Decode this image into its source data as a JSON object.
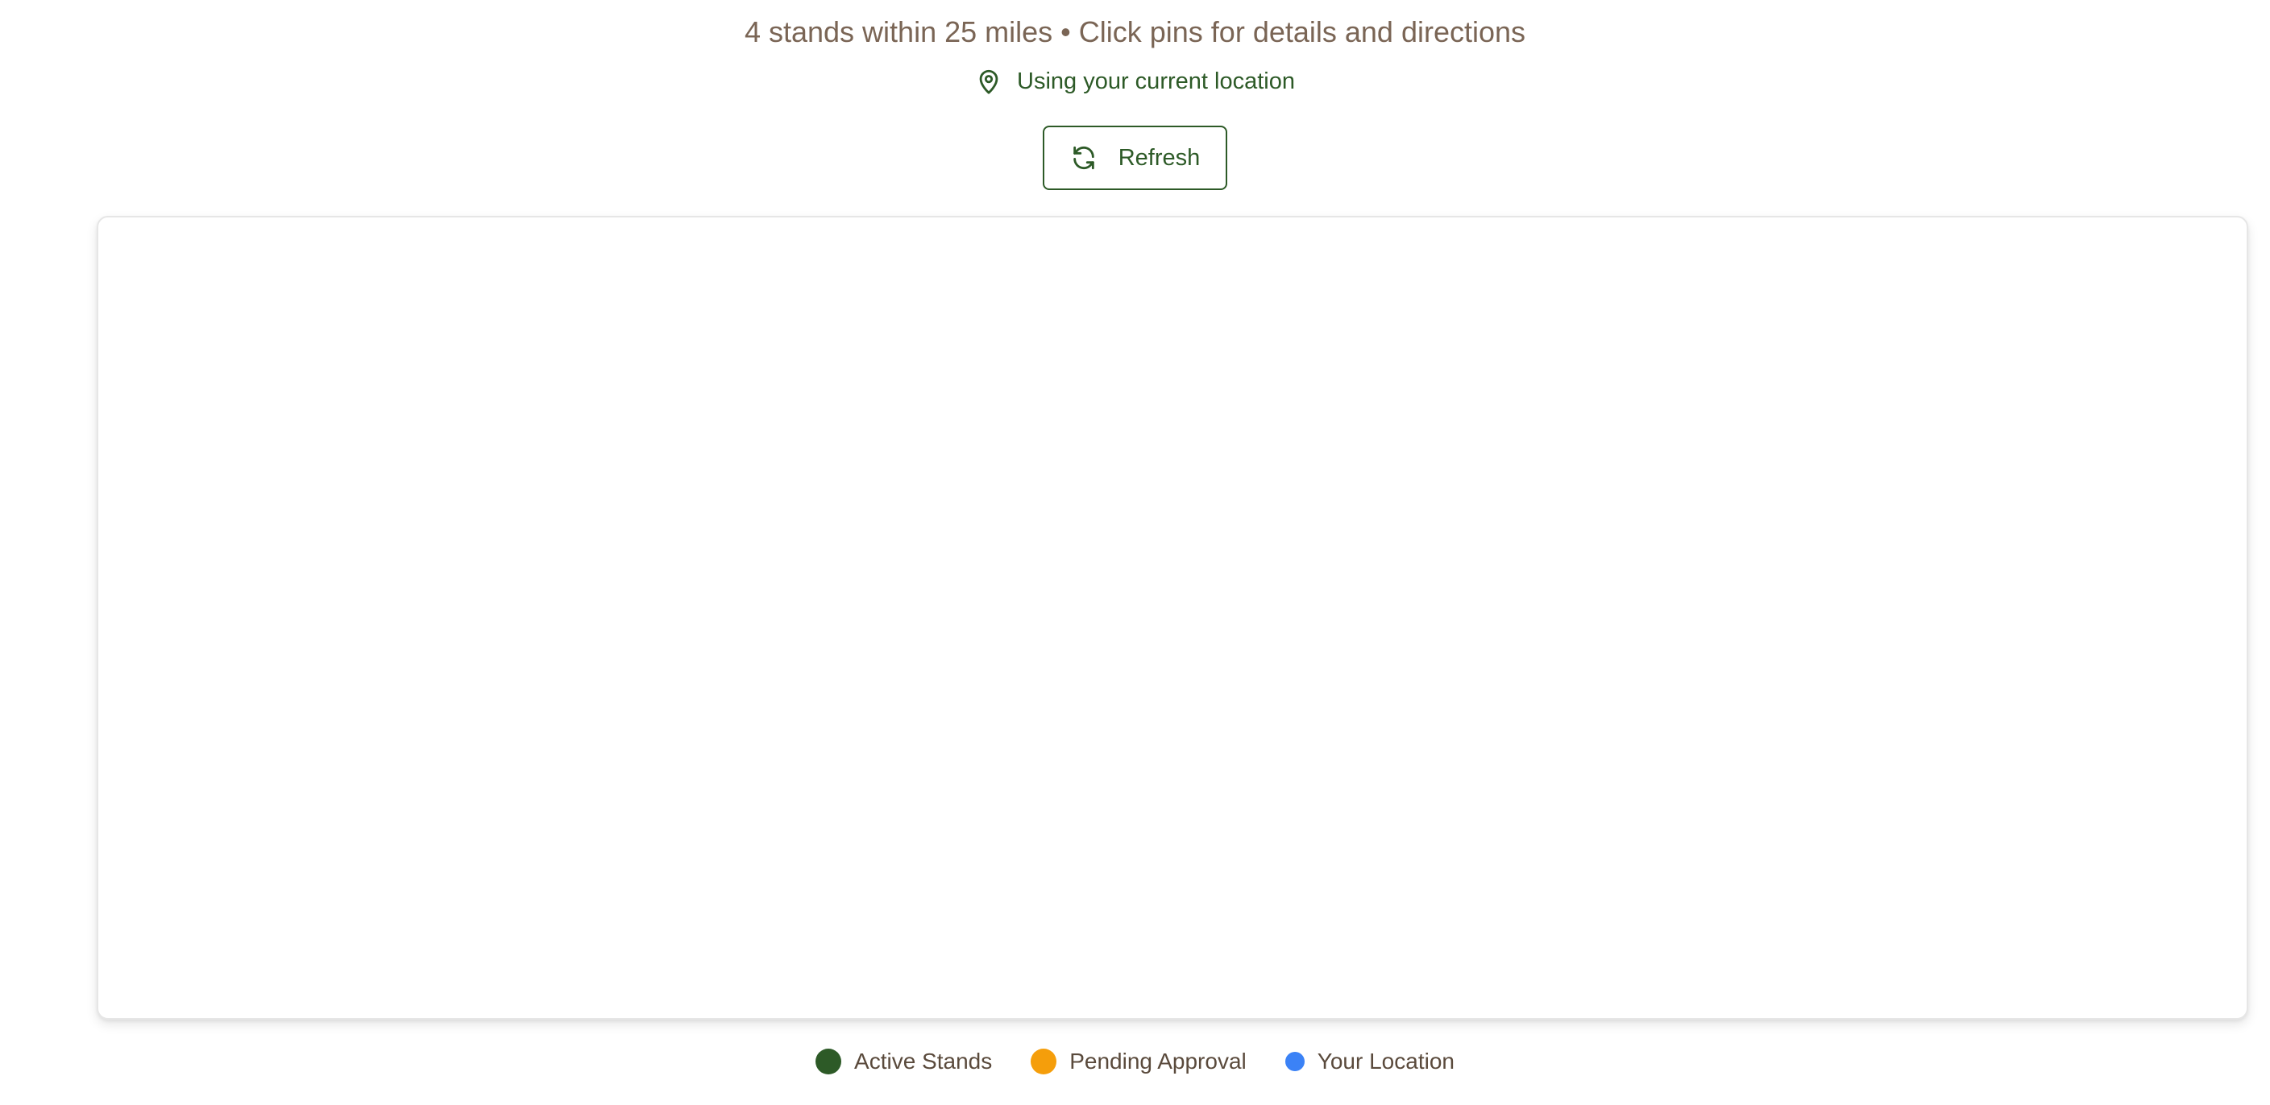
{
  "header": {
    "summary": "4 stands within 25 miles • Click pins for details and directions",
    "location_status": "Using your current location",
    "location_icon": "map-pin-icon"
  },
  "toolbar": {
    "refresh_label": "Refresh",
    "refresh_icon": "refresh-icon"
  },
  "legend": {
    "items": [
      {
        "label": "Active Stands",
        "color": "#2d5a27"
      },
      {
        "label": "Pending Approval",
        "color": "#f59e0b"
      },
      {
        "label": "Your Location",
        "color": "#3b82f6"
      }
    ]
  },
  "colors": {
    "brand_green": "#2d5a27",
    "muted_brown": "#7a6555"
  }
}
